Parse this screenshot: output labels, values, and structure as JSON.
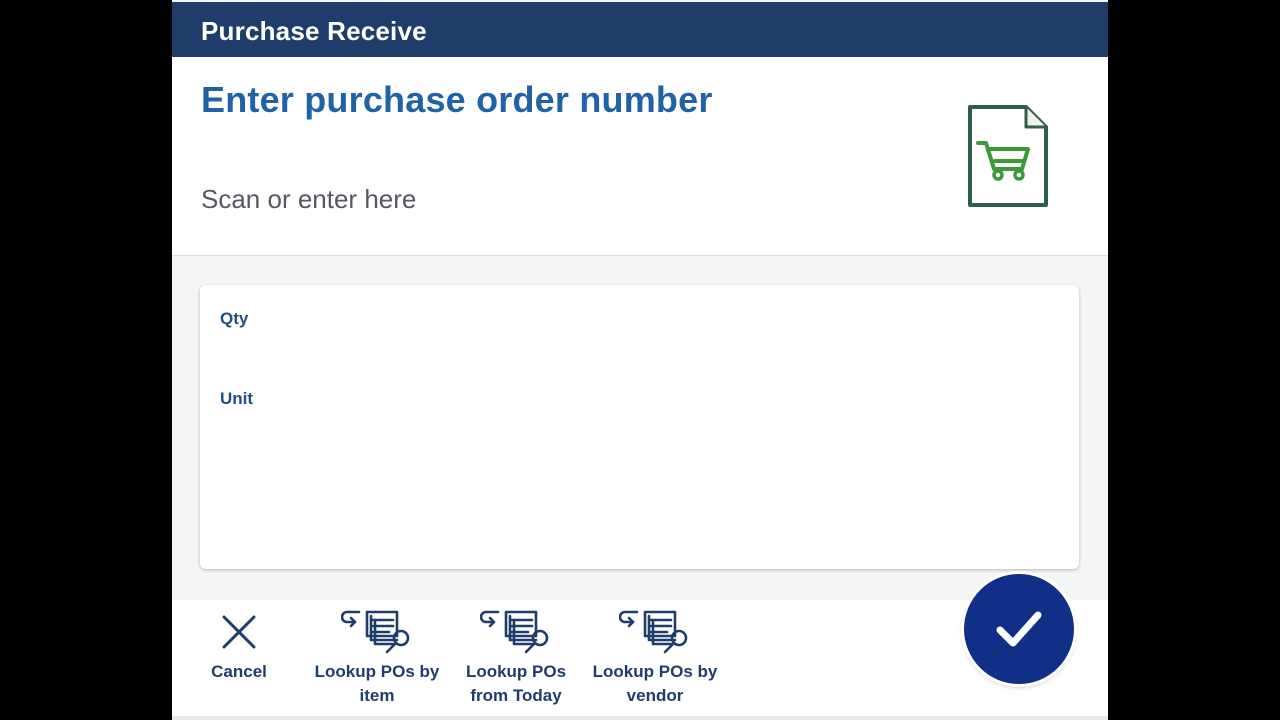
{
  "app": {
    "title": "Purchase Receive"
  },
  "prompt": {
    "title": "Enter purchase order number",
    "input_placeholder": "Scan or enter here",
    "input_value": "",
    "icon": "shopping-cart-document-icon"
  },
  "details": {
    "qty_label": "Qty",
    "unit_label": "Unit"
  },
  "actions": {
    "cancel_line1": "Cancel",
    "lookup_item_line1": "Lookup POs by",
    "lookup_item_line2": "item",
    "lookup_today_line1": "Lookup POs",
    "lookup_today_line2": "from Today",
    "lookup_vendor_line1": "Lookup POs by",
    "lookup_vendor_line2": "vendor"
  },
  "colors": {
    "header_bg": "#1f3d6b",
    "title_blue": "#1f62a8",
    "confirm_bg": "#102f86",
    "cart_green": "#3a9a3a"
  }
}
